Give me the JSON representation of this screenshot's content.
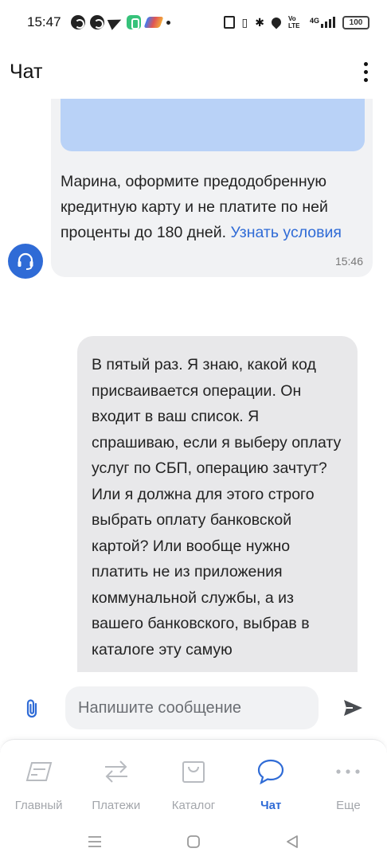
{
  "status_bar": {
    "time": "15:47",
    "network": "4G",
    "battery": "100",
    "volte": "Vo LTE"
  },
  "header": {
    "title": "Чат"
  },
  "messages": {
    "bot": {
      "text": "Марина, оформите предодобренную кредитную карту и не платите по ней проценты до 180 дней.",
      "link": "Узнать условия",
      "time": "15:46"
    },
    "user": {
      "text": "В пятый раз. Я знаю, какой код присваивается операции. Он входит в ваш список. Я спрашиваю, если я выберу оплату услуг по СБП, операцию зачтут? Или я должна для этого строго выбрать оплату банковской картой? Или вообще нужно платить не из приложения коммунальной службы, а из вашего банковского, выбрав в каталоге эту самую"
    }
  },
  "composer": {
    "placeholder": "Напишите сообщение"
  },
  "nav": {
    "items": [
      {
        "label": "Главный",
        "icon": "home-card-icon",
        "active": false
      },
      {
        "label": "Платежи",
        "icon": "transfer-arrows-icon",
        "active": false
      },
      {
        "label": "Каталог",
        "icon": "shopping-bag-icon",
        "active": false
      },
      {
        "label": "Чат",
        "icon": "chat-bubble-icon",
        "active": true
      },
      {
        "label": "Еще",
        "icon": "more-dots-icon",
        "active": false
      }
    ]
  },
  "colors": {
    "accent": "#2f6bd6",
    "bot_bubble": "#f1f2f4",
    "user_bubble": "#e8e8ea",
    "promo": "#b9d2f7",
    "nav_inactive": "#a3a6ab"
  }
}
